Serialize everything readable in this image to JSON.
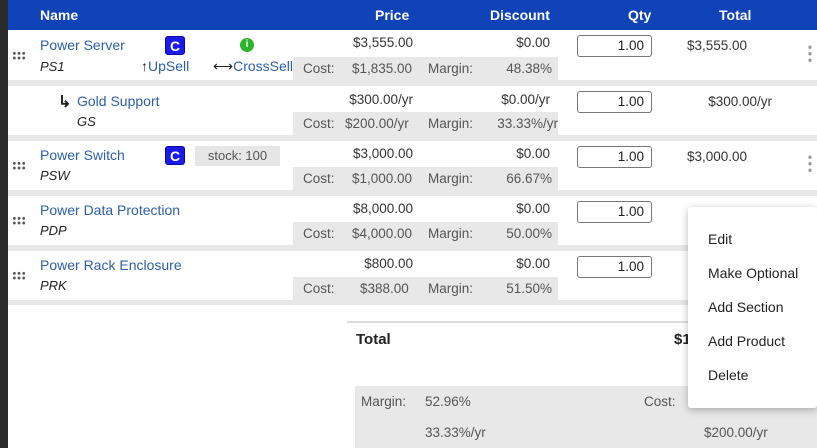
{
  "header": {
    "name": "Name",
    "price": "Price",
    "discount": "Discount",
    "qty": "Qty",
    "total": "Total"
  },
  "cost_label": "Cost:",
  "margin_label": "Margin:",
  "rows": [
    {
      "name": "Power Server",
      "code": "PS1",
      "badge": "C",
      "info": "i",
      "upsell": "UpSell",
      "crosssell": "CrossSell",
      "price": "$3,555.00",
      "discount": "$0.00",
      "cost": "$1,835.00",
      "margin": "48.38%",
      "qty": "1.00",
      "total": "$3,555.00"
    },
    {
      "name": "Gold Support",
      "code": "GS",
      "price": "$300.00/yr",
      "discount": "$0.00/yr",
      "cost": "$200.00/yr",
      "margin": "33.33%/yr",
      "qty": "1.00",
      "total": "$300.00/yr"
    },
    {
      "name": "Power Switch",
      "code": "PSW",
      "badge": "C",
      "stock": "stock: 100",
      "price": "$3,000.00",
      "discount": "$0.00",
      "cost": "$1,000.00",
      "margin": "66.67%",
      "qty": "1.00",
      "total": "$3,000.00"
    },
    {
      "name": "Power Data Protection",
      "code": "PDP",
      "price": "$8,000.00",
      "discount": "$0.00",
      "cost": "$4,000.00",
      "margin": "50.00%",
      "qty": "1.00"
    },
    {
      "name": "Power Rack Enclosure",
      "code": "PRK",
      "price": "$800.00",
      "discount": "$0.00",
      "cost": "$388.00",
      "margin": "51.50%",
      "qty": "1.00"
    }
  ],
  "summary": {
    "total_label": "Total",
    "total_partial": "$1",
    "margin_value": "52.96%",
    "cost_label": "Cost:",
    "recurring_margin": "33.33%/yr",
    "recurring_total": "$200.00/yr"
  },
  "context_menu": {
    "items": [
      "Edit",
      "Make Optional",
      "Add Section",
      "Add Product",
      "Delete"
    ]
  },
  "colors": {
    "header_bg": "#0f43b7",
    "link": "#2c5fa8",
    "badge": "#1a1aee",
    "info": "#2bb52b"
  }
}
